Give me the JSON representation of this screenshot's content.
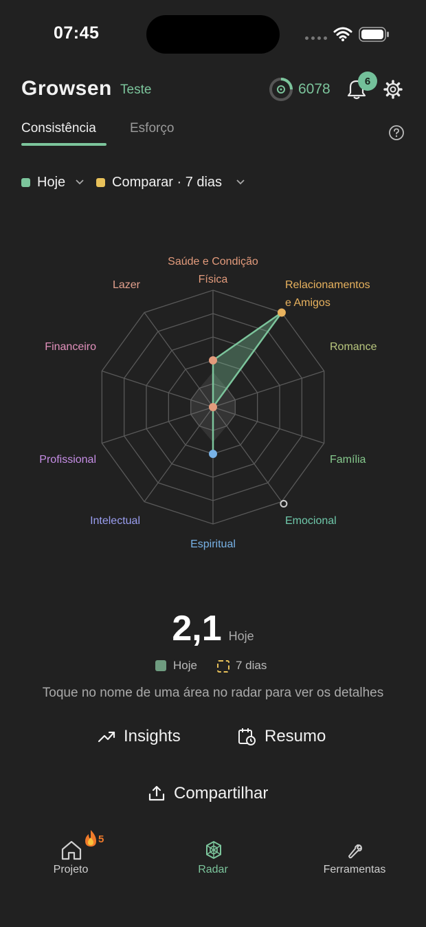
{
  "status_bar": {
    "time": "07:45"
  },
  "header": {
    "brand": "Growsen",
    "user": "Teste",
    "points": "6078",
    "notifications": "6"
  },
  "tabs": [
    {
      "label": "Consistência",
      "active": true
    },
    {
      "label": "Esforço",
      "active": false
    }
  ],
  "filters": {
    "primary": {
      "label": "Hoje",
      "color": "#7cc59c"
    },
    "compare": {
      "label": "Comparar · 7 dias",
      "color": "#e8c15a"
    }
  },
  "radar": {
    "areas": [
      {
        "label_lines": [
          "Saúde e Condição",
          "Física"
        ],
        "color": "#e39b7c"
      },
      {
        "label_lines": [
          "Relacionamentos",
          "e Amigos"
        ],
        "color": "#e8b25e"
      },
      {
        "label_lines": [
          "Romance"
        ],
        "color": "#b9c77e"
      },
      {
        "label_lines": [
          "Família"
        ],
        "color": "#86c98d"
      },
      {
        "label_lines": [
          "Emocional"
        ],
        "color": "#6fc8aa"
      },
      {
        "label_lines": [
          "Espiritual"
        ],
        "color": "#78b2e6"
      },
      {
        "label_lines": [
          "Intelectual"
        ],
        "color": "#9a9ef0"
      },
      {
        "label_lines": [
          "Profissional"
        ],
        "color": "#c68ee6"
      },
      {
        "label_lines": [
          "Financeiro"
        ],
        "color": "#e391bd"
      },
      {
        "label_lines": [
          "Lazer"
        ],
        "color": "#e3a08d"
      }
    ],
    "levels": 5,
    "today_values": [
      2,
      5,
      0,
      0,
      0,
      2,
      0,
      0,
      0,
      0
    ],
    "week_values": [
      1.5,
      1,
      1,
      1,
      1,
      1.5,
      1,
      1,
      1,
      1
    ]
  },
  "score": {
    "value": "2,1",
    "unit": "Hoje"
  },
  "legend": {
    "today": "Hoje",
    "week": "7 dias"
  },
  "hint": "Toque no nome de uma área no radar para ver os detalhes",
  "actions": {
    "insights": "Insights",
    "summary": "Resumo",
    "share": "Compartilhar"
  },
  "nav": {
    "project": "Projeto",
    "streak": "5",
    "radar": "Radar",
    "tools": "Ferramentas"
  }
}
